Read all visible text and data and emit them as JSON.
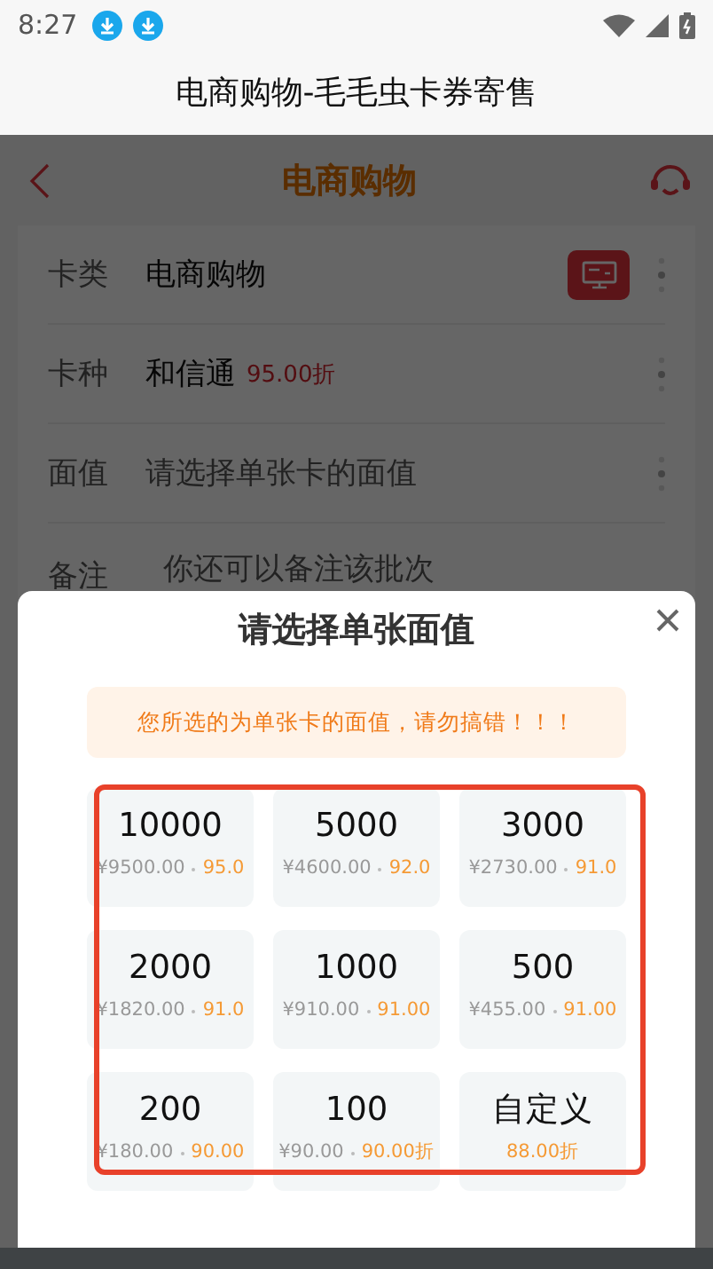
{
  "status_bar": {
    "time": "8:27"
  },
  "app_title": "电商购物-毛毛虫卡券寄售",
  "header": {
    "title": "电商购物"
  },
  "form": [
    {
      "kind": "category",
      "label": "卡类",
      "value": "电商购物"
    },
    {
      "kind": "card",
      "label": "卡种",
      "value": "和信通",
      "discount": "95.00折"
    },
    {
      "kind": "select",
      "label": "面值",
      "placeholder": "请选择单张卡的面值"
    },
    {
      "kind": "note",
      "label": "备注",
      "placeholder": "你还可以备注该批次"
    }
  ],
  "picker": {
    "title": "请选择单张面值",
    "notice": "您所选的为单张卡的面值，请勿搞错！！！",
    "options": [
      {
        "kind": "preset",
        "value": "10000",
        "price": "¥9500.00",
        "discount": "95.0"
      },
      {
        "kind": "preset",
        "value": "5000",
        "price": "¥4600.00",
        "discount": "92.0"
      },
      {
        "kind": "preset",
        "value": "3000",
        "price": "¥2730.00",
        "discount": "91.0"
      },
      {
        "kind": "preset",
        "value": "2000",
        "price": "¥1820.00",
        "discount": "91.0"
      },
      {
        "kind": "preset",
        "value": "1000",
        "price": "¥910.00",
        "discount": "91.00"
      },
      {
        "kind": "preset",
        "value": "500",
        "price": "¥455.00",
        "discount": "91.00"
      },
      {
        "kind": "preset",
        "value": "200",
        "price": "¥180.00",
        "discount": "90.00"
      },
      {
        "kind": "preset",
        "value": "100",
        "price": "¥90.00",
        "discount": "90.00折"
      },
      {
        "kind": "custom",
        "value": "自定义",
        "discount": "88.00折"
      }
    ]
  }
}
